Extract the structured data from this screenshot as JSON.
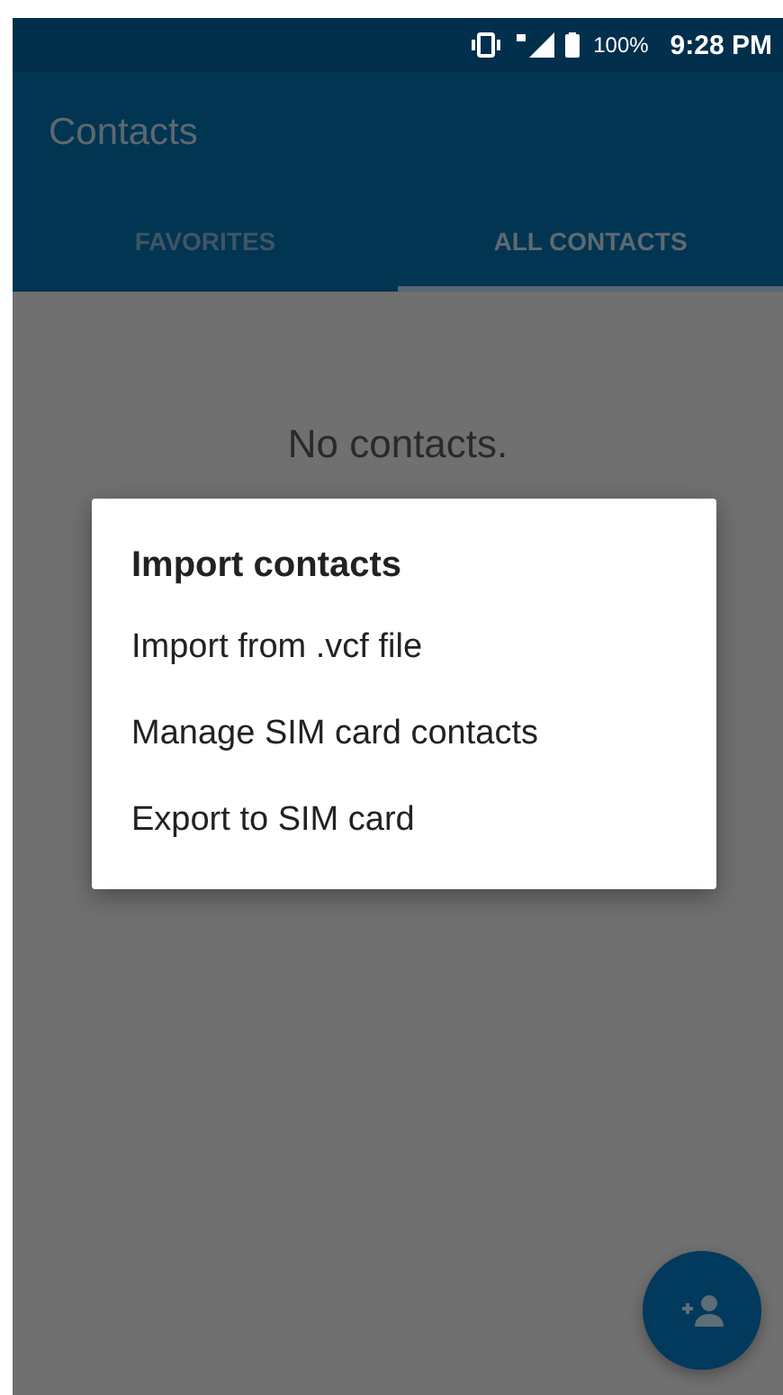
{
  "status_bar": {
    "battery": "100%",
    "time": "9:28 PM"
  },
  "toolbar": {
    "title": "Contacts"
  },
  "tabs": [
    {
      "label": "FAVORITES",
      "selected": false
    },
    {
      "label": "ALL CONTACTS",
      "selected": true
    }
  ],
  "empty_message": "No contacts.",
  "dialog": {
    "title": "Import contacts",
    "items": [
      "Import from .vcf file",
      "Manage SIM card contacts",
      "Export to SIM card"
    ]
  }
}
